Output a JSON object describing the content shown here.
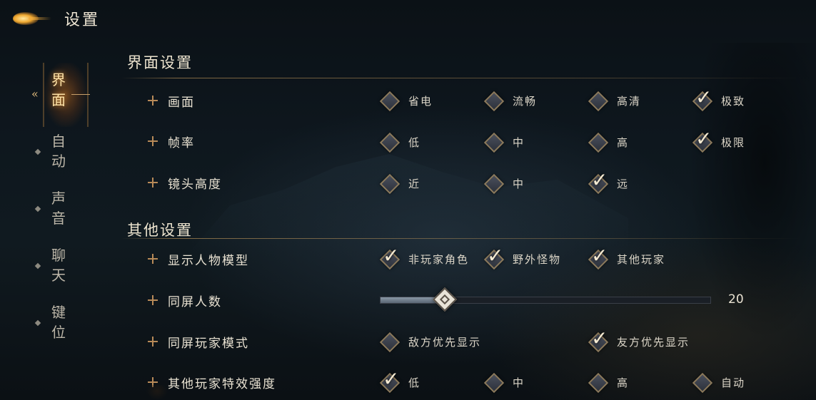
{
  "header": {
    "title": "设置",
    "logo_icon": "golden-flame-icon"
  },
  "nav": {
    "items": [
      {
        "label": "界面",
        "chars": [
          "界",
          "面"
        ],
        "active": true
      },
      {
        "label": "自动",
        "chars": [
          "自",
          "动"
        ],
        "active": false
      },
      {
        "label": "声音",
        "chars": [
          "声",
          "音"
        ],
        "active": false
      },
      {
        "label": "聊天",
        "chars": [
          "聊",
          "天"
        ],
        "active": false
      },
      {
        "label": "键位",
        "chars": [
          "键",
          "位"
        ],
        "active": false
      }
    ]
  },
  "sections": {
    "interface": {
      "title": "界面设置",
      "rows": {
        "quality": {
          "label": "画面",
          "options": [
            {
              "label": "省电",
              "checked": false
            },
            {
              "label": "流畅",
              "checked": false
            },
            {
              "label": "高清",
              "checked": false
            },
            {
              "label": "极致",
              "checked": true
            }
          ]
        },
        "framerate": {
          "label": "帧率",
          "options": [
            {
              "label": "低",
              "checked": false
            },
            {
              "label": "中",
              "checked": false
            },
            {
              "label": "高",
              "checked": false
            },
            {
              "label": "极限",
              "checked": true
            }
          ]
        },
        "camera": {
          "label": "镜头高度",
          "options": [
            {
              "label": "近",
              "checked": false
            },
            {
              "label": "中",
              "checked": false
            },
            {
              "label": "远",
              "checked": true
            }
          ]
        }
      }
    },
    "other": {
      "title": "其他设置",
      "rows": {
        "models": {
          "label": "显示人物模型",
          "options": [
            {
              "label": "非玩家角色",
              "checked": true
            },
            {
              "label": "野外怪物",
              "checked": true
            },
            {
              "label": "其他玩家",
              "checked": true
            }
          ]
        },
        "count": {
          "label": "同屏人数",
          "value": "20",
          "slider_fraction": 0.19
        },
        "mode": {
          "label": "同屏玩家模式",
          "options": [
            {
              "label": "敌方优先显示",
              "checked": false
            },
            {
              "label": "友方优先显示",
              "checked": true
            }
          ]
        },
        "effects": {
          "label": "其他玩家特效强度",
          "options": [
            {
              "label": "低",
              "checked": true
            },
            {
              "label": "中",
              "checked": false
            },
            {
              "label": "高",
              "checked": false
            },
            {
              "label": "自动",
              "checked": false
            }
          ]
        }
      }
    }
  },
  "colors": {
    "accent_gold": "#c8a06a",
    "check_white": "#f4ead2"
  }
}
